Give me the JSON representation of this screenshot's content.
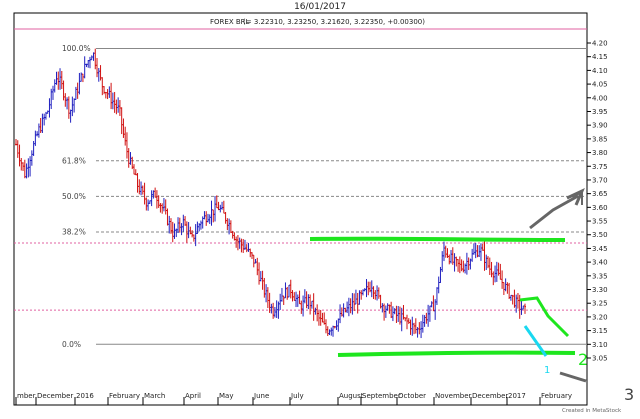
{
  "header": {
    "date": "16/01/2017",
    "instrument_label": "FOREX BRL",
    "quote": "(= 3.22310, 3.23250, 3.21620, 3.22350, +0.00300)"
  },
  "footer": {
    "credit": "Created in MetaStock"
  },
  "annotations": {
    "up_label": "1",
    "mid_label": "2",
    "right_label": "3"
  },
  "colors": {
    "bull": "#2020c0",
    "bear": "#d01010",
    "fib_line": "#888888",
    "pink_line": "#e060a0",
    "support_resistance": "#1ee61e",
    "arrows": "#666666",
    "projection_cyan": "#19d8f0"
  },
  "chart_data": {
    "type": "ohlc",
    "title": "FOREX BRL",
    "xlabel": "",
    "ylabel": "",
    "ylim": [
      3.02,
      4.25
    ],
    "y_ticks": [
      4.2,
      4.15,
      4.1,
      4.05,
      4.0,
      3.95,
      3.9,
      3.85,
      3.8,
      3.75,
      3.7,
      3.65,
      3.6,
      3.55,
      3.5,
      3.45,
      3.4,
      3.35,
      3.3,
      3.25,
      3.2,
      3.15,
      3.1,
      3.05
    ],
    "x_ticks": [
      "mber",
      "December",
      "2016",
      "February",
      "March",
      "April",
      "May",
      "June",
      "July",
      "August",
      "September",
      "October",
      "November",
      "December",
      "2017",
      "February"
    ],
    "fibonacci_levels": [
      {
        "label": "100.0%",
        "value": 4.18
      },
      {
        "label": "61.8%",
        "value": 3.77
      },
      {
        "label": "50.0%",
        "value": 3.64
      },
      {
        "label": "38.2%",
        "value": 3.51
      },
      {
        "label": "0.0%",
        "value": 3.1
      }
    ],
    "pink_lines": [
      4.28,
      3.47,
      3.225
    ],
    "path_points": [
      {
        "x": 1,
        "y": 3.83
      },
      {
        "x": 3,
        "y": 3.72
      },
      {
        "x": 4,
        "y": 3.78
      },
      {
        "x": 6,
        "y": 3.88
      },
      {
        "x": 8,
        "y": 3.95
      },
      {
        "x": 10,
        "y": 4.08
      },
      {
        "x": 11,
        "y": 4.05
      },
      {
        "x": 13,
        "y": 3.95
      },
      {
        "x": 14,
        "y": 4.0
      },
      {
        "x": 16,
        "y": 4.1
      },
      {
        "x": 18,
        "y": 4.17
      },
      {
        "x": 20,
        "y": 4.05
      },
      {
        "x": 22,
        "y": 4.0
      },
      {
        "x": 24,
        "y": 3.95
      },
      {
        "x": 25,
        "y": 3.85
      },
      {
        "x": 26,
        "y": 3.78
      },
      {
        "x": 28,
        "y": 3.68
      },
      {
        "x": 30,
        "y": 3.62
      },
      {
        "x": 32,
        "y": 3.65
      },
      {
        "x": 34,
        "y": 3.58
      },
      {
        "x": 36,
        "y": 3.5
      },
      {
        "x": 38,
        "y": 3.55
      },
      {
        "x": 40,
        "y": 3.48
      },
      {
        "x": 42,
        "y": 3.55
      },
      {
        "x": 44,
        "y": 3.58
      },
      {
        "x": 46,
        "y": 3.6
      },
      {
        "x": 48,
        "y": 3.55
      },
      {
        "x": 50,
        "y": 3.48
      },
      {
        "x": 52,
        "y": 3.45
      },
      {
        "x": 54,
        "y": 3.4
      },
      {
        "x": 56,
        "y": 3.3
      },
      {
        "x": 58,
        "y": 3.22
      },
      {
        "x": 60,
        "y": 3.28
      },
      {
        "x": 62,
        "y": 3.3
      },
      {
        "x": 64,
        "y": 3.24
      },
      {
        "x": 66,
        "y": 3.26
      },
      {
        "x": 68,
        "y": 3.2
      },
      {
        "x": 70,
        "y": 3.15
      },
      {
        "x": 72,
        "y": 3.18
      },
      {
        "x": 74,
        "y": 3.22
      },
      {
        "x": 76,
        "y": 3.25
      },
      {
        "x": 78,
        "y": 3.28
      },
      {
        "x": 80,
        "y": 3.32
      },
      {
        "x": 82,
        "y": 3.25
      },
      {
        "x": 84,
        "y": 3.22
      },
      {
        "x": 86,
        "y": 3.2
      },
      {
        "x": 88,
        "y": 3.18
      },
      {
        "x": 90,
        "y": 3.15
      },
      {
        "x": 92,
        "y": 3.2
      },
      {
        "x": 94,
        "y": 3.25
      },
      {
        "x": 96,
        "y": 3.45
      },
      {
        "x": 98,
        "y": 3.4
      },
      {
        "x": 100,
        "y": 3.38
      },
      {
        "x": 102,
        "y": 3.42
      },
      {
        "x": 104,
        "y": 3.45
      },
      {
        "x": 106,
        "y": 3.38
      },
      {
        "x": 108,
        "y": 3.35
      },
      {
        "x": 110,
        "y": 3.3
      },
      {
        "x": 112,
        "y": 3.25
      },
      {
        "x": 114,
        "y": 3.22
      }
    ]
  }
}
